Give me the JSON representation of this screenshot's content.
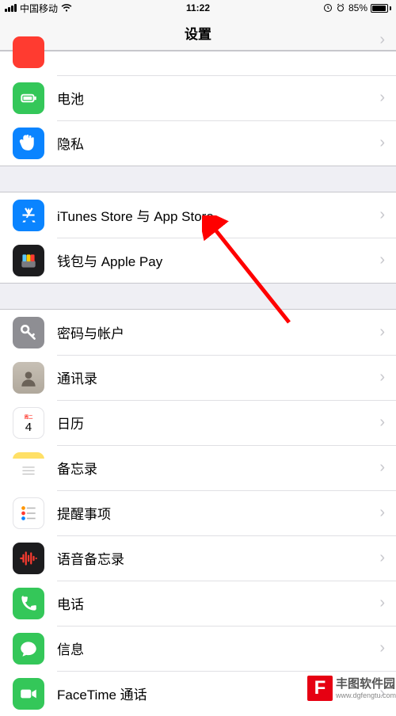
{
  "status": {
    "carrier": "中国移动",
    "time": "11:22",
    "battery_pct": "85%",
    "battery_fill_pct": 85
  },
  "nav": {
    "title": "设置"
  },
  "sections": [
    {
      "rows": [
        {
          "icon": "warning-icon",
          "iconClass": "ic-warn",
          "label": "",
          "cut": true
        },
        {
          "icon": "battery-icon",
          "iconClass": "ic-battery",
          "label": "电池"
        },
        {
          "icon": "hand-icon",
          "iconClass": "ic-privacy",
          "label": "隐私"
        }
      ]
    },
    {
      "rows": [
        {
          "icon": "appstore-icon",
          "iconClass": "ic-appstore",
          "label": "iTunes Store 与 App Store"
        },
        {
          "icon": "wallet-icon",
          "iconClass": "ic-wallet",
          "label": "钱包与 Apple Pay"
        }
      ]
    },
    {
      "rows": [
        {
          "icon": "key-icon",
          "iconClass": "ic-passwords",
          "label": "密码与帐户"
        },
        {
          "icon": "contact-icon",
          "iconClass": "ic-contacts",
          "label": "通讯录"
        },
        {
          "icon": "calendar-icon",
          "iconClass": "ic-calendar",
          "label": "日历"
        },
        {
          "icon": "notes-icon",
          "iconClass": "ic-notes",
          "label": "备忘录"
        },
        {
          "icon": "reminders-icon",
          "iconClass": "ic-reminders",
          "label": "提醒事项"
        },
        {
          "icon": "waveform-icon",
          "iconClass": "ic-voice",
          "label": "语音备忘录"
        },
        {
          "icon": "phone-icon",
          "iconClass": "ic-phone",
          "label": "电话"
        },
        {
          "icon": "message-icon",
          "iconClass": "ic-messages",
          "label": "信息"
        },
        {
          "icon": "video-icon",
          "iconClass": "ic-facetime",
          "label": "FaceTime 通话"
        }
      ]
    }
  ],
  "annotation": {
    "arrow_color": "#ff0000"
  },
  "watermark": {
    "logo": "F",
    "title": "丰图软件园",
    "url": "www.dgfengtu.com"
  }
}
